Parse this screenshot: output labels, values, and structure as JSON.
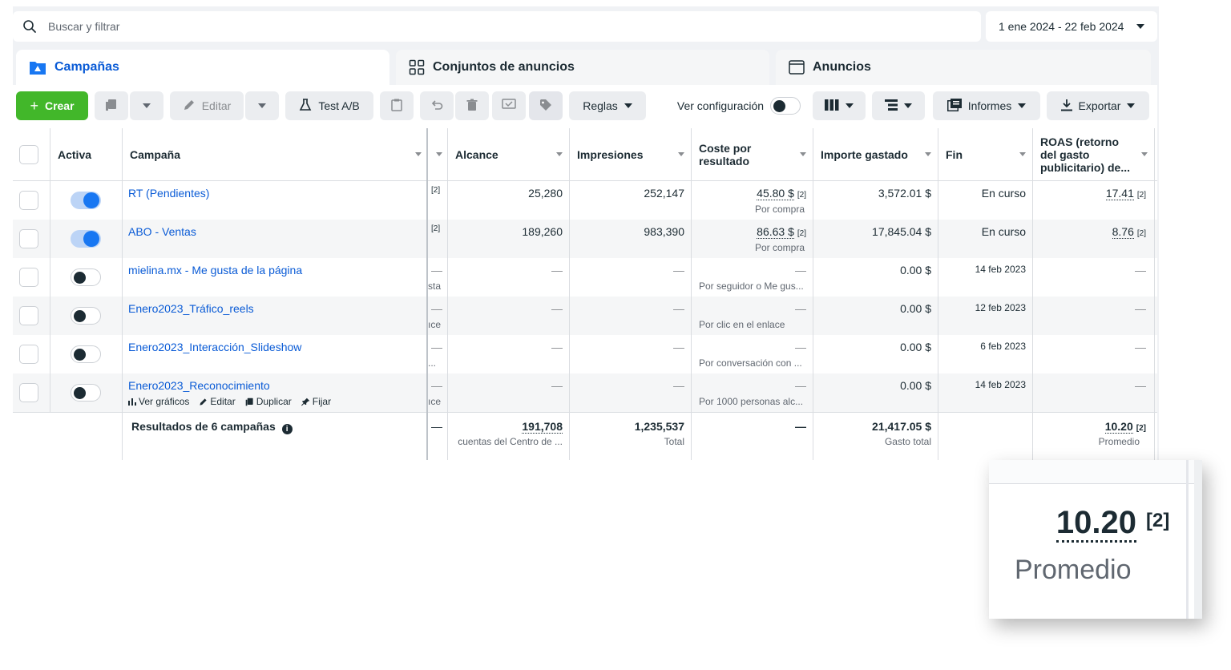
{
  "search": {
    "placeholder": "Buscar y filtrar"
  },
  "date_range": {
    "label": "1 ene 2024 - 22 feb 2024"
  },
  "tabs": [
    {
      "label": "Campañas",
      "active": true
    },
    {
      "label": "Conjuntos de anuncios",
      "active": false
    },
    {
      "label": "Anuncios",
      "active": false
    }
  ],
  "toolbar": {
    "create": "Crear",
    "edit": "Editar",
    "ab_test": "Test A/B",
    "rules": "Reglas",
    "view_settings": "Ver configuración",
    "reports": "Informes",
    "export": "Exportar"
  },
  "columns": {
    "active": "Activa",
    "campaign": "Campaña",
    "reach": "Alcance",
    "impressions": "Impresiones",
    "cost_per_result_1": "Coste por",
    "cost_per_result_2": "resultado",
    "amount_spent": "Importe gastado",
    "end": "Fin",
    "roas_1": "ROAS (retorno",
    "roas_2": "del gasto",
    "roas_3": "publicitario) de..."
  },
  "rows": [
    {
      "name": "RT (Pendientes)",
      "active": true,
      "partial_mark": "[2]",
      "partial_sub": "",
      "reach": "25,280",
      "impressions": "252,147",
      "cost": "45.80 $",
      "cost_mark": "[2]",
      "cost_sub": "Por compra",
      "spent": "3,572.01 $",
      "end": "En curso",
      "roas": "17.41",
      "roas_mark": "[2]"
    },
    {
      "name": "ABO - Ventas",
      "active": true,
      "partial_mark": "[2]",
      "partial_sub": "",
      "reach": "189,260",
      "impressions": "983,390",
      "cost": "86.63 $",
      "cost_mark": "[2]",
      "cost_sub": "Por compra",
      "spent": "17,845.04 $",
      "end": "En curso",
      "roas": "8.76",
      "roas_mark": "[2]"
    },
    {
      "name": "mielina.mx - Me gusta de la página",
      "active": false,
      "partial_mark": "—",
      "partial_sub": "sta",
      "reach": "—",
      "impressions": "—",
      "cost": "—",
      "cost_mark": "",
      "cost_sub": "Por seguidor o Me gus...",
      "spent": "0.00 $",
      "end": "14 feb 2023",
      "roas": "—",
      "roas_mark": ""
    },
    {
      "name": "Enero2023_Tráfico_reels",
      "active": false,
      "partial_mark": "—",
      "partial_sub": "ıce",
      "reach": "—",
      "impressions": "—",
      "cost": "—",
      "cost_mark": "",
      "cost_sub": "Por clic en el enlace",
      "spent": "0.00 $",
      "end": "12 feb 2023",
      "roas": "—",
      "roas_mark": ""
    },
    {
      "name": "Enero2023_Interacción_Slideshow",
      "active": false,
      "partial_mark": "—",
      "partial_sub": "...",
      "reach": "—",
      "impressions": "—",
      "cost": "—",
      "cost_mark": "",
      "cost_sub": "Por conversación con ...",
      "spent": "0.00 $",
      "end": "6 feb 2023",
      "roas": "—",
      "roas_mark": ""
    },
    {
      "name": "Enero2023_Reconocimiento",
      "active": false,
      "partial_mark": "—",
      "partial_sub": "ıce",
      "reach": "—",
      "impressions": "—",
      "cost": "—",
      "cost_mark": "",
      "cost_sub": "Por 1000 personas alc...",
      "spent": "0.00 $",
      "end": "14 feb 2023",
      "roas": "—",
      "roas_mark": ""
    }
  ],
  "row_actions": {
    "charts": "Ver gráficos",
    "edit": "Editar",
    "duplicate": "Duplicar",
    "pin": "Fijar"
  },
  "totals": {
    "label": "Resultados de 6 campañas",
    "partial": "—",
    "reach": "191,708",
    "reach_sub": "cuentas del Centro de ...",
    "impressions": "1,235,537",
    "impressions_sub": "Total",
    "cost": "—",
    "spent": "21,417.05 $",
    "spent_sub": "Gasto total",
    "roas": "10.20",
    "roas_mark": "[2]",
    "roas_sub": "Promedio"
  },
  "zoom": {
    "value": "10.20",
    "mark": "[2]",
    "label": "Promedio"
  }
}
